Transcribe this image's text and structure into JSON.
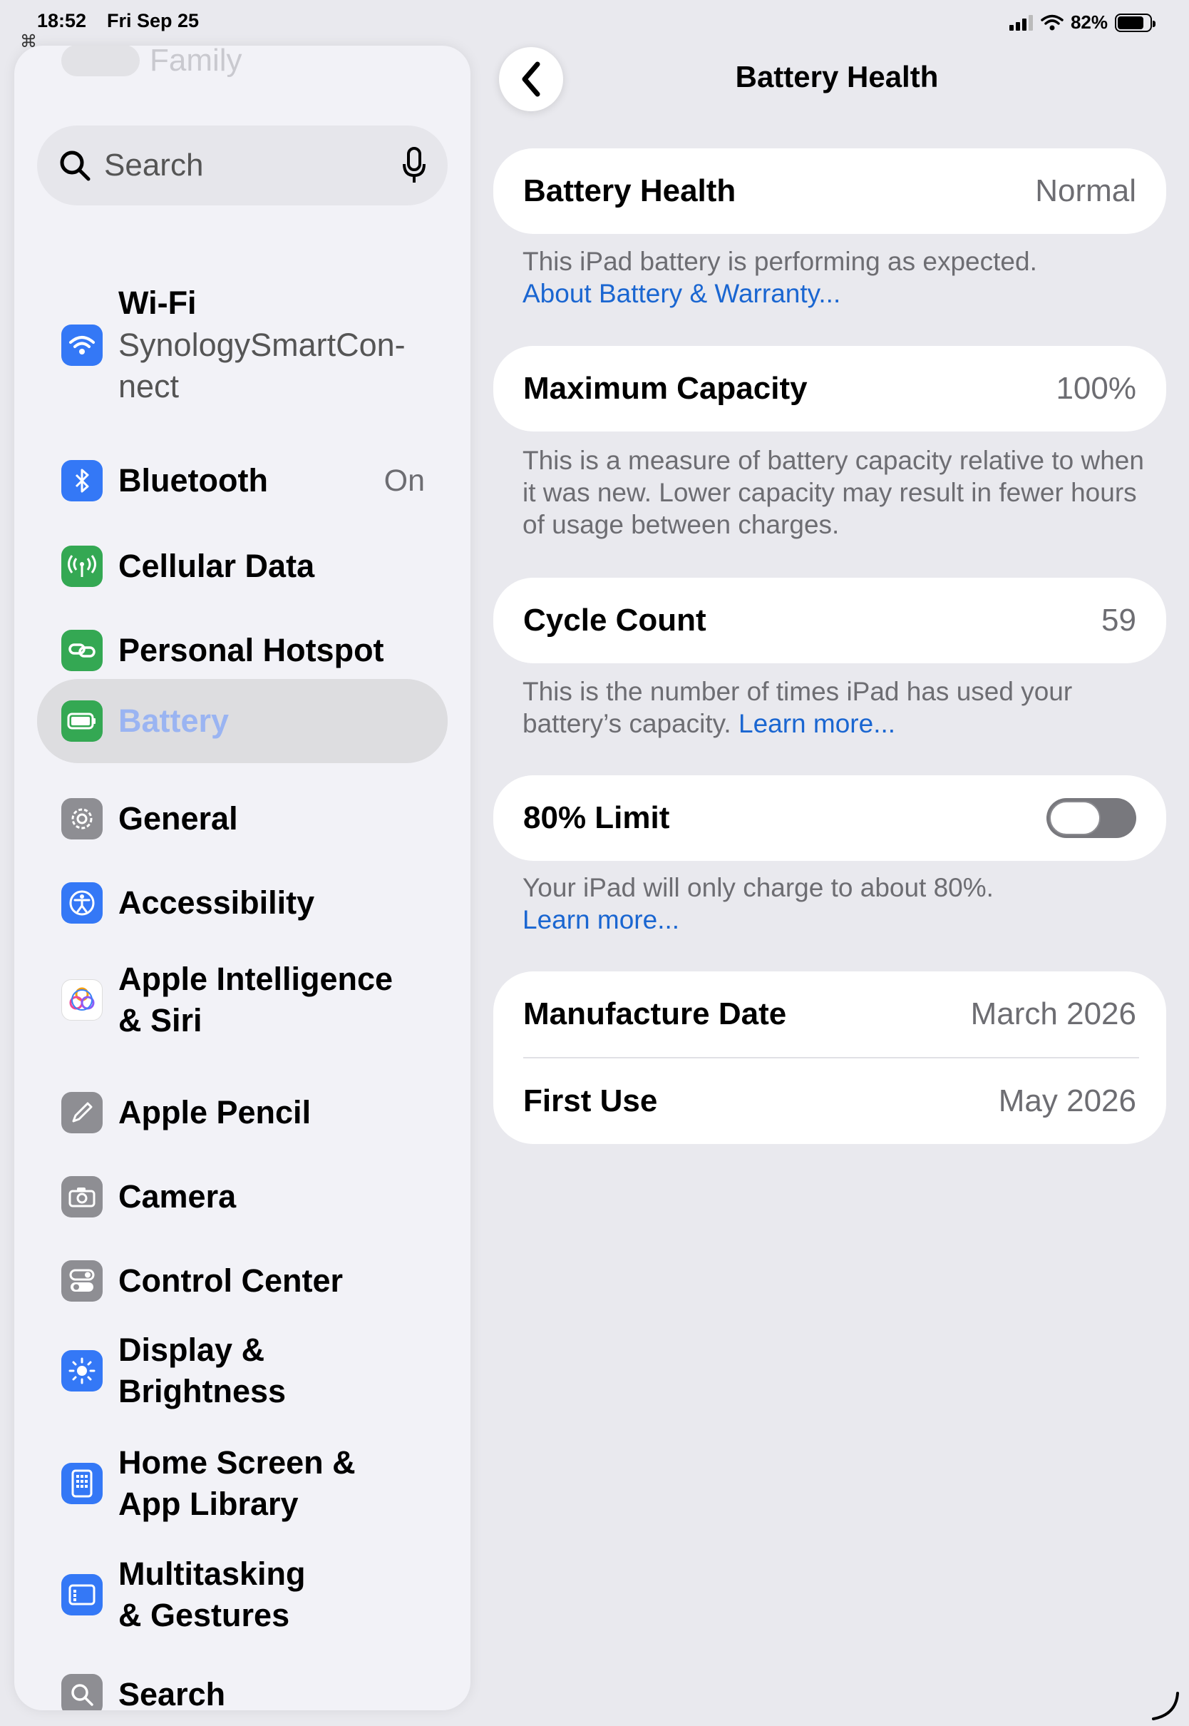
{
  "status_bar": {
    "time": "18:52",
    "date": "Fri Sep 25",
    "battery_percent": "82%",
    "battery_level": 0.82
  },
  "sidebar": {
    "family_label": "Family",
    "search_placeholder": "Search",
    "items": [
      {
        "label": "Wi-Fi",
        "sub": "SynologySmartCon-\nnect",
        "icon": "wifi-icon",
        "color": "#3478f6"
      },
      {
        "label": "Bluetooth",
        "value": "On",
        "icon": "bluetooth-icon",
        "color": "#3478f6"
      },
      {
        "label": "Cellular Data",
        "icon": "antenna-icon",
        "color": "#34a853"
      },
      {
        "label": "Personal Hotspot",
        "icon": "link-icon",
        "color": "#34a853"
      },
      {
        "label": "Battery",
        "icon": "battery-icon",
        "color": "#34a853",
        "selected": true
      },
      {
        "label": "General",
        "icon": "gear-icon",
        "color": "#8e8e93"
      },
      {
        "label": "Accessibility",
        "icon": "accessibility-icon",
        "color": "#3478f6"
      },
      {
        "label": "Apple Intelligence\n& Siri",
        "icon": "apple-intelligence-icon",
        "color": "#ffffff"
      },
      {
        "label": "Apple Pencil",
        "icon": "pencil-icon",
        "color": "#8e8e93"
      },
      {
        "label": "Camera",
        "icon": "camera-icon",
        "color": "#8e8e93"
      },
      {
        "label": "Control Center",
        "icon": "toggles-icon",
        "color": "#8e8e93"
      },
      {
        "label": "Display &\nBrightness",
        "icon": "sun-icon",
        "color": "#3478f6"
      },
      {
        "label": "Home Screen &\nApp Library",
        "icon": "home-screen-icon",
        "color": "#3478f6"
      },
      {
        "label": "Multitasking\n& Gestures",
        "icon": "multitasking-icon",
        "color": "#3478f6"
      },
      {
        "label": "Search",
        "icon": "search-icon",
        "color": "#8e8e93"
      }
    ]
  },
  "detail": {
    "title": "Battery Health",
    "battery_health": {
      "label": "Battery Health",
      "value": "Normal"
    },
    "battery_health_note": "This iPad battery is performing as expected.",
    "battery_health_link": "About Battery & Warranty...",
    "max_capacity": {
      "label": "Maximum Capacity",
      "value": "100%"
    },
    "max_capacity_note": "This is a measure of battery capacity relative to when it was new. Lower capacity may result in fewer hours of usage between charges.",
    "cycle_count": {
      "label": "Cycle Count",
      "value": "59"
    },
    "cycle_count_note": "This is the number of times iPad has used your battery’s capacity.",
    "cycle_count_link": "Learn more...",
    "limit": {
      "label": "80% Limit",
      "enabled": false
    },
    "limit_note": "Your iPad will only charge to about 80%.",
    "limit_link": "Learn more...",
    "manufacture_date": {
      "label": "Manufacture Date",
      "value": "March 2026"
    },
    "first_use": {
      "label": "First Use",
      "value": "May 2026"
    }
  }
}
